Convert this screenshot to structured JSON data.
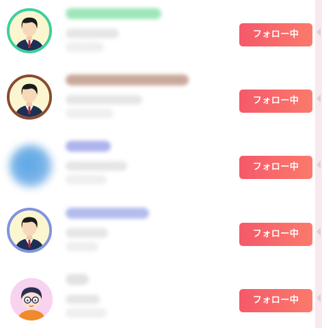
{
  "follow_list": {
    "rows": [
      {
        "follow_button_label": "フォロー中",
        "avatar_icon": "person-avatar-icon",
        "ring_color": "#3ecf9d",
        "name_color": "#9ee6b8"
      },
      {
        "follow_button_label": "フォロー中",
        "avatar_icon": "person-avatar-icon",
        "ring_color": "#8b4a2f",
        "name_color": "#c9a99a"
      },
      {
        "follow_button_label": "フォロー中",
        "avatar_icon": "blurred-photo-avatar",
        "ring_color": "",
        "name_color": "#aeb4ec"
      },
      {
        "follow_button_label": "フォロー中",
        "avatar_icon": "person-avatar-icon",
        "ring_color": "#7f93e0",
        "name_color": "#b3bcec"
      },
      {
        "follow_button_label": "フォロー中",
        "avatar_icon": "glasses-avatar-icon",
        "ring_color": "",
        "name_color": "#e2e2e2"
      }
    ]
  },
  "colors": {
    "follow_button_start": "#f5596a",
    "follow_button_end": "#fb7a6b",
    "edge_strip": "#f7e9ee"
  }
}
